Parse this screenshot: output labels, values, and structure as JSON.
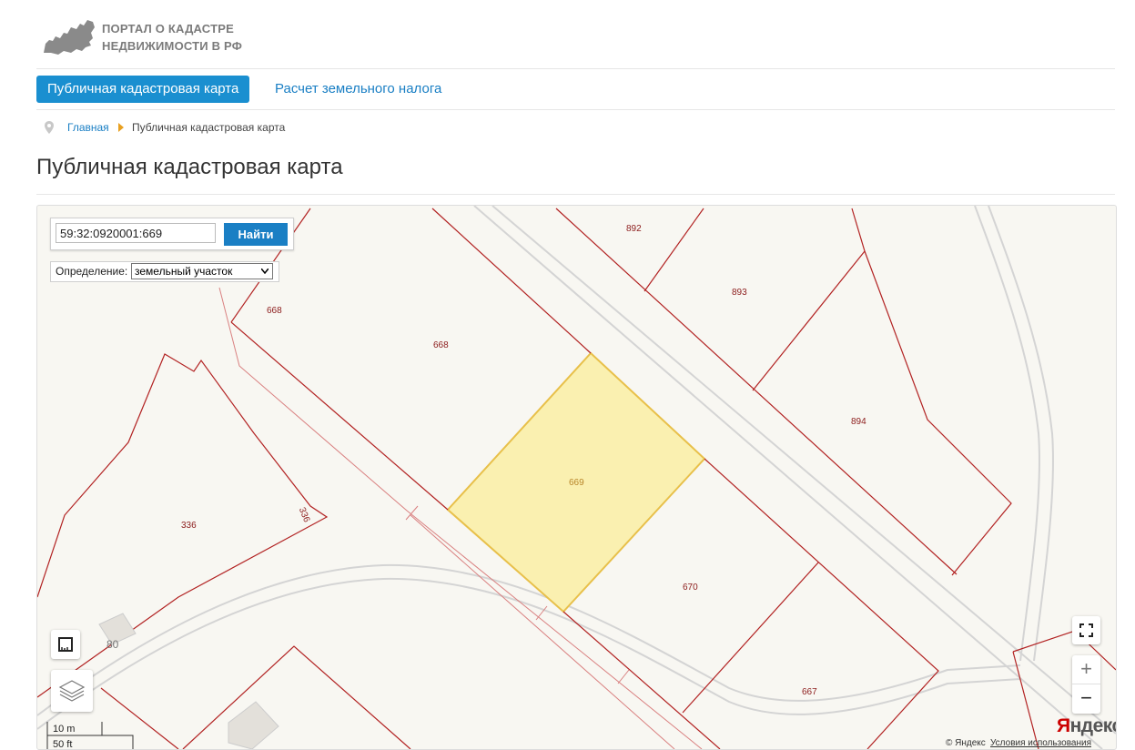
{
  "header": {
    "logo_line1": "ПОРТАЛ О КАДАСТРЕ",
    "logo_line2": "НЕДВИЖИМОСТИ В РФ"
  },
  "nav": {
    "active_tab": "Публичная кадастровая карта",
    "tab_tax": "Расчет земельного налога"
  },
  "breadcrumb": {
    "home": "Главная",
    "current": "Публичная кадастровая карта"
  },
  "page_title": "Публичная кадастровая карта",
  "map": {
    "search": {
      "value": "59:32:0920001:669",
      "button": "Найти"
    },
    "definition": {
      "label": "Определение:",
      "selected": "земельный участок"
    },
    "parcels": {
      "p892": "892",
      "p893": "893",
      "p894": "894",
      "p668a": "668",
      "p668b": "668",
      "p669": "669",
      "p670": "670",
      "p667": "667",
      "p336": "336",
      "p336b": "336"
    },
    "building": "80",
    "scale": {
      "meters": "10 m",
      "feet": "50 ft"
    },
    "attribution": {
      "copyright": "© Яндекс",
      "terms": "Условия использования",
      "logo_first": "Я",
      "logo_rest": "ндекс"
    },
    "colors": {
      "parcel_border": "#b22222",
      "selected_fill": "#faf0b0",
      "selected_border": "#e8c04a",
      "road": "#d8d8d8",
      "background": "#f8f7f2"
    }
  }
}
